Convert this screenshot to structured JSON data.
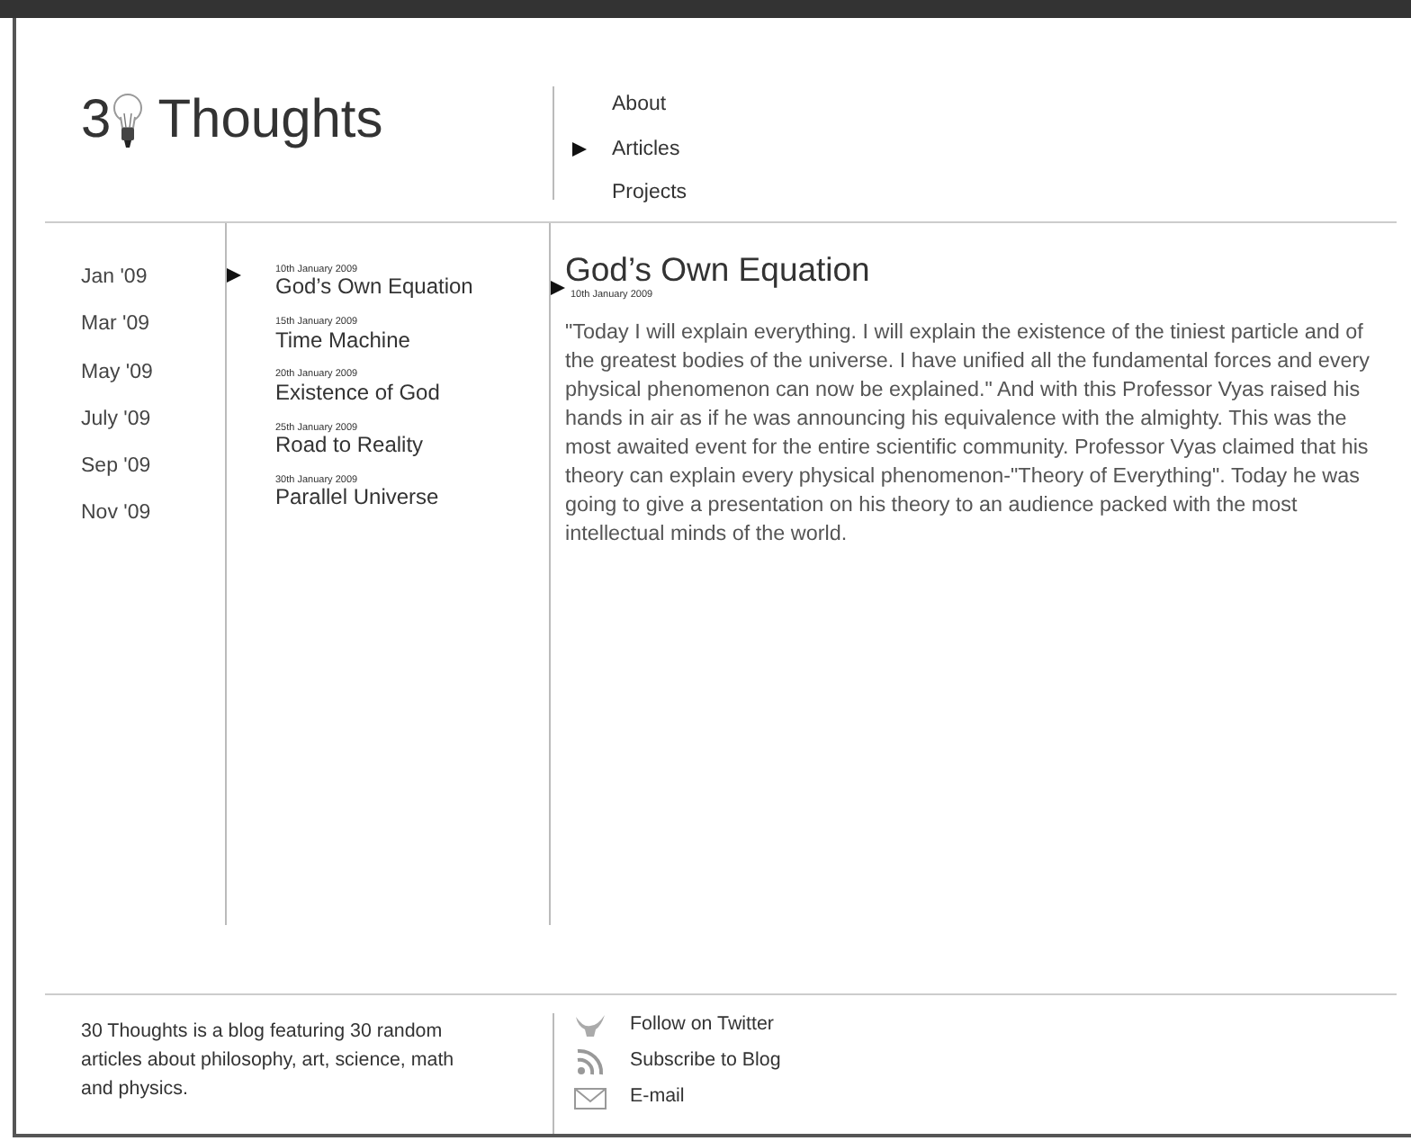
{
  "logo": {
    "text_before": "3",
    "text_after": "Thoughts"
  },
  "nav": [
    {
      "label": "About",
      "selected": false
    },
    {
      "label": "Articles",
      "selected": true
    },
    {
      "label": "Projects",
      "selected": false
    }
  ],
  "months": [
    "Jan '09",
    "Mar '09",
    "May '09",
    "July '09",
    "Sep '09",
    "Nov '09"
  ],
  "articles": [
    {
      "date": "10th January 2009",
      "title": "God’s Own Equation",
      "selected": true
    },
    {
      "date": "15th January 2009",
      "title": "Time Machine",
      "selected": false
    },
    {
      "date": "20th January 2009",
      "title": "Existence of God",
      "selected": false
    },
    {
      "date": "25th January 2009",
      "title": "Road to Reality",
      "selected": false
    },
    {
      "date": "30th January 2009",
      "title": "Parallel Universe",
      "selected": false
    }
  ],
  "post": {
    "title": "God’s Own Equation",
    "date": "10th January 2009",
    "body": "\"Today I will explain everything. I will explain the existence of the tiniest particle and of the greatest bodies of the universe. I have unified all the fundamental forces and every physical phenomenon can now be explained.\" And with this Professor Vyas raised his hands in air as if he was announcing his equivalence with the almighty. This was the most awaited event for the entire scientific community. Professor Vyas  claimed that his theory can explain every physical phenomenon-\"Theory of Everything\". Today he was going to give a presentation on his theory to an audience packed with the most intellectual minds of the world."
  },
  "footer": {
    "about": "30 Thoughts is a blog featuring 30 random articles about philosophy, art, science, math and physics.",
    "links": [
      {
        "kind": "twitter",
        "label": "Follow on Twitter"
      },
      {
        "kind": "rss",
        "label": "Subscribe to Blog"
      },
      {
        "kind": "email",
        "label": "E-mail"
      }
    ]
  }
}
